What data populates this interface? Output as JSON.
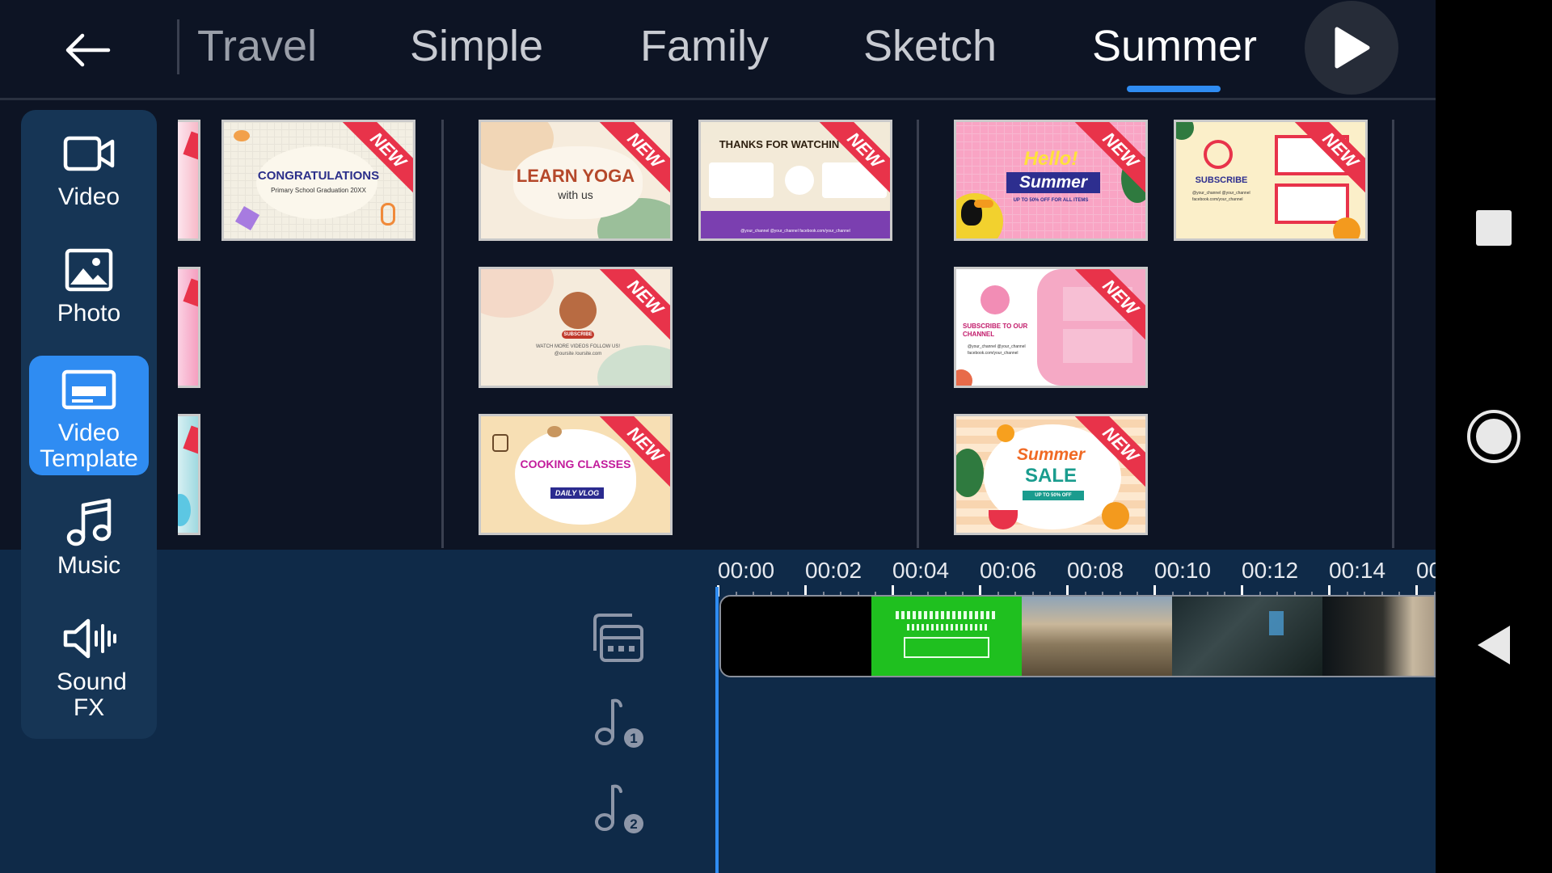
{
  "topbar": {
    "tabs": [
      {
        "label": "Travel"
      },
      {
        "label": "Simple"
      },
      {
        "label": "Family"
      },
      {
        "label": "Sketch"
      },
      {
        "label": "Summer"
      }
    ],
    "active_tab": "Summer",
    "back_icon": "arrow-left-icon",
    "play_icon": "play-icon"
  },
  "sidebar": {
    "items": [
      {
        "label": "Video",
        "icon": "video-camera-icon"
      },
      {
        "label": "Photo",
        "icon": "photo-icon"
      },
      {
        "label": "Video Template",
        "icon": "video-template-icon",
        "active": true
      },
      {
        "label": "Music",
        "icon": "music-note-icon"
      },
      {
        "label": "Sound FX",
        "icon": "speaker-icon"
      }
    ]
  },
  "templates": {
    "badge": "NEW",
    "family": [
      {
        "title": "CONGRATULATIONS",
        "subtitle": "Primary School Graduation 20XX"
      }
    ],
    "sketch": [
      {
        "title": "LEARN YOGA",
        "subtitle": "with us"
      },
      {
        "title": "THANKS FOR WATCHIN",
        "subtitle": "@your_channel   @your_channel   facebook.com/your_channel"
      },
      {
        "title": "SUBSCRIBE",
        "subtitle": "WATCH MORE VIDEOS  FOLLOW US!  @oursite /oursite.com"
      },
      {
        "title": "COOKING CLASSES",
        "subtitle": "DAILY VLOG"
      }
    ],
    "summer": [
      {
        "title": "Hello!",
        "title2": "Summer",
        "subtitle": "UP TO 50% OFF FOR ALL ITEMS"
      },
      {
        "title": "SUBSCRIBE",
        "subtitle": "@your_channel  @your_channel  facebook.com/your_channel"
      },
      {
        "title": "SUBSCRIBE TO OUR CHANNEL",
        "subtitle": "@your_channel  @your_channel  facebook.com/your_channel"
      },
      {
        "title": "Summer",
        "title2": "SALE",
        "subtitle": "UP TO 50% OFF"
      }
    ]
  },
  "timeline": {
    "ticks": [
      "00:00",
      "00:02",
      "00:04",
      "00:06",
      "00:08",
      "00:10",
      "00:12",
      "00:14",
      "00"
    ],
    "track_icons": [
      "layers-icon",
      "music-track-1-icon",
      "music-track-2-icon"
    ],
    "track_numbers": [
      "1",
      "2"
    ]
  },
  "navbar": {
    "icons": [
      "recents-square-icon",
      "home-circle-icon",
      "back-triangle-icon"
    ]
  },
  "colors": {
    "background": "#0d1424",
    "sidebar": "#163555",
    "accent": "#2f8cf2",
    "timeline": "#0f2a48",
    "badge": "#e8334a"
  }
}
